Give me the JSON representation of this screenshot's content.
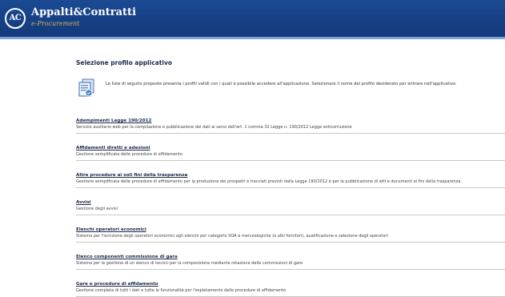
{
  "header": {
    "logo_text": "AC",
    "title": "Appalti&Contratti",
    "subtitle": "e-Procurement"
  },
  "page": {
    "title": "Selezione profilo applicativo",
    "intro": "Le liste di seguito proposte presenta i profili validi con i quali è possibile accedere all'applicazione. Selezionare il nome del profilo desiderato per entrare nell'applicativo."
  },
  "profiles": [
    {
      "title": "Adempimenti Legge 190/2012",
      "description": "Servizio ausiliario web per la compilazione e pubblicazione dei dati ai sensi dell'art. 1 comma 32 Legge n. 190/2012 Legge anticorruzione"
    },
    {
      "title": "Affidamenti diretti e adesioni",
      "description": "Gestione semplificata delle procedure di affidamento"
    },
    {
      "title": "Altre procedure ai soli fini della trasparenza",
      "description": "Gestione semplificata delle procedure di affidamento per la produzione dei prospetti e tracciati previsti dalla Legge 190/2012 e per la pubblicazione di atti e documenti ai fini della trasparenza"
    },
    {
      "title": "Avvisi",
      "description": "Gestione degli avvisi"
    },
    {
      "title": "Elenchi operatori economici",
      "description": "Sistema per l'iscrizione degli operatori economici agli elenchi per categorie SOA e merceologiche (o albi fornitori), qualificazione e selezione degli operatori"
    },
    {
      "title": "Elenco componenti commissione di gara",
      "description": "Sistema per la gestione di un elenco di tecnici per la composizione mediante rotazione delle commissioni di gare"
    },
    {
      "title": "Gare e procedure di affidamento",
      "description": "Gestione completa di tutti i dati e tutte le funzionalità per l'espletamento delle procedure di affidamento"
    }
  ]
}
